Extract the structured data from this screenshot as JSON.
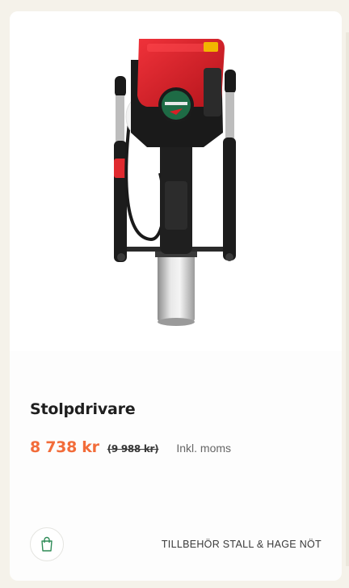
{
  "product": {
    "name": "Stolpdrivare",
    "price": "8 738 kr",
    "old_price": "(9 988 kr)",
    "tax_note": "Inkl. moms",
    "category": "TILLBEHÖR STALL & HAGE NÖT",
    "image_alt": "Stolpdrivare product image",
    "cart_icon": "shopping-bag-icon"
  },
  "colors": {
    "price_accent": "#f26c3a",
    "engine_red": "#d91f26",
    "icon_green": "#2e8b57",
    "background": "#f5f2ea"
  }
}
